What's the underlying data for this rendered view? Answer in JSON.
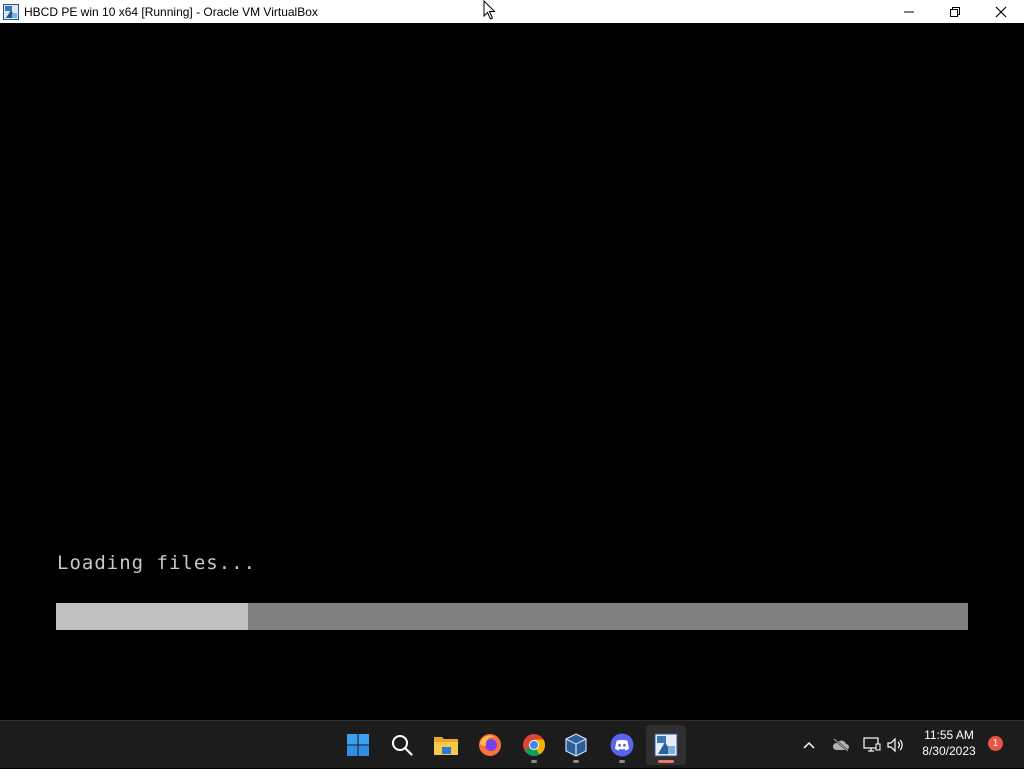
{
  "window": {
    "title": "HBCD PE win 10 x64 [Running] - Oracle VM VirtualBox",
    "controls": [
      "minimize-icon",
      "restore-icon",
      "close-icon"
    ]
  },
  "vm": {
    "loading_text": "Loading files...",
    "progress_fraction": 0.21,
    "colors": {
      "track": "#808080",
      "fill": "#c0c0c0",
      "text": "#c8c8c8"
    }
  },
  "taskbar": {
    "items": [
      {
        "name": "start-icon"
      },
      {
        "name": "search-icon"
      },
      {
        "name": "file-explorer-icon"
      },
      {
        "name": "firefox-icon"
      },
      {
        "name": "chrome-icon"
      },
      {
        "name": "virtualbox-icon"
      },
      {
        "name": "discord-icon"
      },
      {
        "name": "virtualbox-vm-icon"
      }
    ],
    "tray": {
      "icons": [
        "chevron-up-icon",
        "cloud-offline-icon",
        "network-icon",
        "volume-icon"
      ],
      "time": "11:55 AM",
      "date": "8/30/2023",
      "notification_count": "1"
    }
  }
}
